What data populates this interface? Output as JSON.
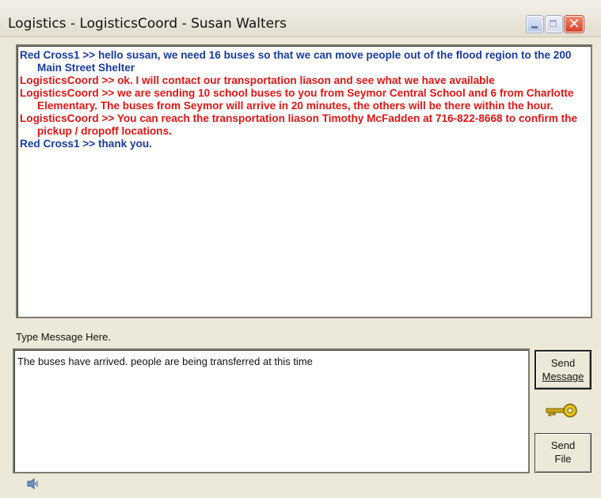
{
  "window": {
    "title": "Logistics - LogisticsCoord - Susan Walters"
  },
  "chat": {
    "messages": [
      {
        "sender_color": "#1a3ca0",
        "text": "Red Cross1 >> hello susan, we need 16 buses so that we can move people out of the flood region to the 200 Main Street Shelter"
      },
      {
        "sender_color": "#e01515",
        "text": "LogisticsCoord >> ok. I will contact our transportation liason and see what we have available"
      },
      {
        "sender_color": "#e01515",
        "text": "LogisticsCoord >> we are sending 10 school buses to you from Seymor Central School and 6 from Charlotte Elementary.  The buses from Seymor will arrive in 20 minutes, the others will be there within the hour."
      },
      {
        "sender_color": "#e01515",
        "text": "LogisticsCoord >> You can reach the transportation liason Timothy McFadden at 716-822-8668 to confirm the pickup / dropoff locations."
      },
      {
        "sender_color": "#1a3ca0",
        "text": "Red Cross1 >> thank you."
      }
    ]
  },
  "compose": {
    "label": "Type Message Here.",
    "value": "The buses have arrived. people are being transferred at this time"
  },
  "buttons": {
    "send_message_line1": "Send",
    "send_message_line2": "Message",
    "send_file_line1": "Send",
    "send_file_line2": "File"
  },
  "icons": {
    "key": "key-icon",
    "speaker": "speaker-icon"
  },
  "colors": {
    "remote_user": "#1a3ca0",
    "local_user": "#e01515"
  }
}
